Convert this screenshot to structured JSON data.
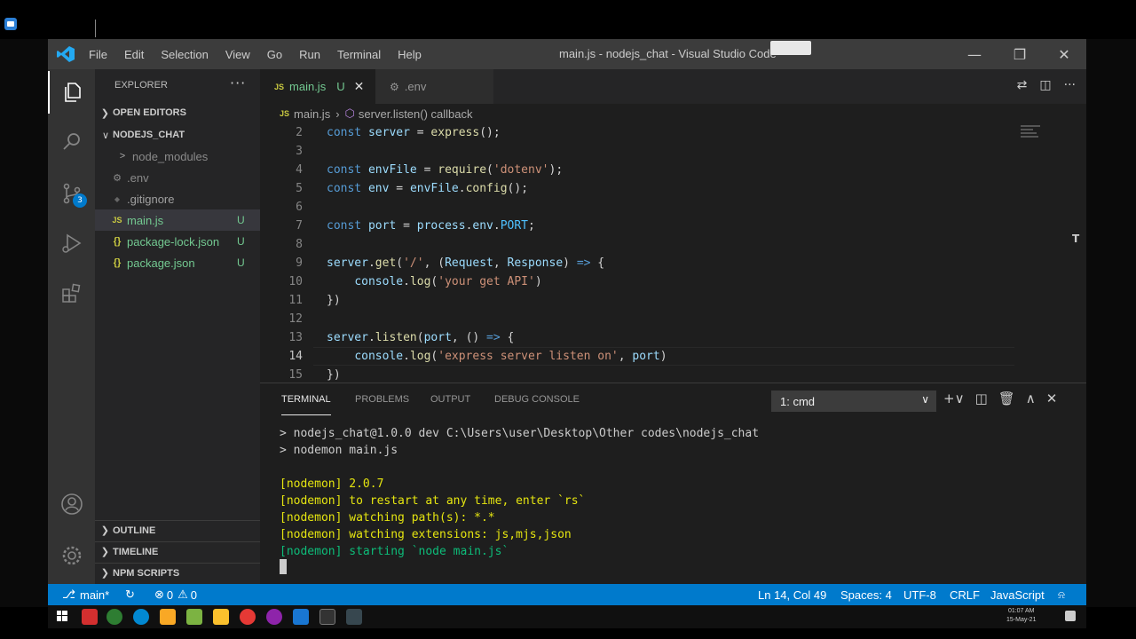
{
  "window": {
    "title": "main.js - nodejs_chat - Visual Studio Code",
    "menu": [
      "File",
      "Edit",
      "Selection",
      "View",
      "Go",
      "Run",
      "Terminal",
      "Help"
    ],
    "controls": {
      "minimize": "—",
      "restore": "❐",
      "close": "✕"
    }
  },
  "activity": {
    "scm_badge": "3"
  },
  "sidebar": {
    "title": "EXPLORER",
    "more": "···",
    "open_editors": "OPEN EDITORS",
    "folder": "NODEJS_CHAT",
    "items": [
      {
        "label": "node_modules",
        "icon": ">",
        "status": ""
      },
      {
        "label": ".env",
        "icon": "⚙",
        "status": ""
      },
      {
        "label": ".gitignore",
        "icon": "◆",
        "status": ""
      },
      {
        "label": "main.js",
        "icon": "JS",
        "status": "U"
      },
      {
        "label": "package-lock.json",
        "icon": "{}",
        "status": "U"
      },
      {
        "label": "package.json",
        "icon": "{}",
        "status": "U"
      }
    ],
    "outline": "OUTLINE",
    "timeline": "TIMELINE",
    "npm_scripts": "NPM SCRIPTS"
  },
  "tabs": [
    {
      "label": "main.js",
      "badge": "JS",
      "status": "U",
      "close": "✕"
    },
    {
      "label": ".env",
      "icon": "⚙"
    }
  ],
  "breadcrumb": {
    "file": "main.js",
    "symbol": "server.listen() callback"
  },
  "editor": {
    "lines": [
      {
        "n": "2",
        "code": "const server = express();"
      },
      {
        "n": "3",
        "code": ""
      },
      {
        "n": "4",
        "code": "const envFile = require('dotenv');"
      },
      {
        "n": "5",
        "code": "const env = envFile.config();"
      },
      {
        "n": "6",
        "code": ""
      },
      {
        "n": "7",
        "code": "const port = process.env.PORT;"
      },
      {
        "n": "8",
        "code": ""
      },
      {
        "n": "9",
        "code": "server.get('/', (Request, Response) => {"
      },
      {
        "n": "10",
        "code": "    console.log('your get API')"
      },
      {
        "n": "11",
        "code": "})"
      },
      {
        "n": "12",
        "code": ""
      },
      {
        "n": "13",
        "code": "server.listen(port, () => {"
      },
      {
        "n": "14",
        "code": "    console.log('express server listen on', port)"
      },
      {
        "n": "15",
        "code": "})"
      }
    ]
  },
  "panel": {
    "tabs": [
      "TERMINAL",
      "PROBLEMS",
      "OUTPUT",
      "DEBUG CONSOLE"
    ],
    "terminal_select": "1: cmd",
    "terminal_lines": [
      {
        "text": "> nodejs_chat@1.0.0 dev C:\\Users\\user\\Desktop\\Other codes\\nodejs_chat",
        "color": "#cccccc"
      },
      {
        "text": "> nodemon main.js",
        "color": "#cccccc"
      },
      {
        "text": "",
        "color": "#cccccc"
      },
      {
        "text": "[nodemon] 2.0.7",
        "color": "#e5e510"
      },
      {
        "text": "[nodemon] to restart at any time, enter `rs`",
        "color": "#e5e510"
      },
      {
        "text": "[nodemon] watching path(s): *.*",
        "color": "#e5e510"
      },
      {
        "text": "[nodemon] watching extensions: js,mjs,json",
        "color": "#e5e510"
      },
      {
        "text": "[nodemon] starting `node main.js`",
        "color": "#0dbc79"
      }
    ]
  },
  "statusbar": {
    "branch": "main*",
    "sync": "↻",
    "errors": "0",
    "warnings": "0",
    "position": "Ln 14, Col 49",
    "spaces": "Spaces: 4",
    "encoding": "UTF-8",
    "eol": "CRLF",
    "language": "JavaScript",
    "bell": "🔔"
  },
  "taskbar": {
    "time": "01:07 AM",
    "date": "15-May-21"
  },
  "colors": {
    "accent": "#007acc",
    "titlebar": "#3c3c3c",
    "sidebar": "#252526",
    "editor_bg": "#1e1e1e",
    "untracked": "#73c991"
  }
}
